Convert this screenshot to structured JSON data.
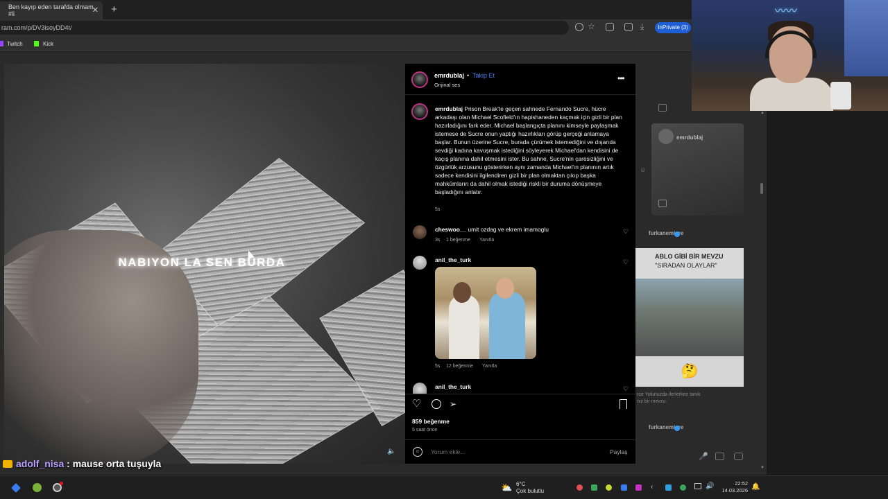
{
  "browser": {
    "tab_title": "Ben kayıp eden tarafda olmam. #li",
    "tab_close": "✕",
    "new_tab": "+",
    "url": "ram.com/p/DV3isoyDD4t/",
    "inprivate_label": "InPrivate (3)",
    "bookmarks": [
      {
        "label": "Twitch",
        "color": "#9146ff"
      },
      {
        "label": "Kick",
        "color": "#53fc18"
      }
    ]
  },
  "video": {
    "overlay_text": "NABIYON LA SEN BURDA",
    "mute_icon": "🔈"
  },
  "post": {
    "username": "emrdublaj",
    "dot": "•",
    "follow_label": "Takip Et",
    "audio_label": "Orijinal ses",
    "more_label": "•••",
    "caption_user": "emrdublaj",
    "caption_text": "Prison Break'te geçen sahnede Fernando Sucre, hücre arkadaşı olan Michael Scofield'ın hapishaneden kaçmak için gizli bir plan hazırladığını fark eder. Michael başlangıçta planını kimseyle paylaşmak istemese de Sucre onun yaptığı hazırlıkları görüp gerçeği anlamaya başlar. Bunun üzerine Sucre, burada çürümek istemediğini ve dışarıda sevdiği kadına kavuşmak istediğini söyleyerek Michael'dan kendisini de kaçış planına dahil etmesini ister. Bu sahne, Sucre'nin çaresizliğini ve özgürlük arzusunu gösterirken aynı zamanda Michael'ın planının artık sadece kendisini ilgilendiren gizli bir plan olmaktan çıkıp başka mahkûmların da dahil olmak istediği riskli bir duruma dönüşmeye başladığını anlatır.",
    "caption_time": "5s",
    "comments": [
      {
        "user": "cheswoo__",
        "text": "umit ozdag ve ekrem imamoglu",
        "time": "3s",
        "likes": "1 beğenme",
        "reply": "Yanıtla"
      },
      {
        "user": "anil_the_turk",
        "text": "",
        "time": "5s",
        "likes": "12 beğenme",
        "reply": "Yanıtla"
      },
      {
        "user": "anil_the_turk",
        "text": "",
        "time": "",
        "likes": "",
        "reply": ""
      }
    ],
    "like_count": "859 beğenme",
    "posted_ago": "5 saat önce",
    "comment_placeholder": "Yorum ekle...",
    "share_label": "Paylaş",
    "emoji_icon": "☺"
  },
  "feed": {
    "card1_user": "emrdublaj",
    "user": "furkanemirce",
    "card2_title": "ABLO GİBİ BİR MEVZU",
    "card2_subtitle": "\"SIRADAN OLAYLAR\"",
    "card3_emoji": "🤔",
    "desc": "rce Yolunuzda ilerlerken tanık\nniz bir mevzu."
  },
  "chat": {
    "username": "adolf_nisa",
    "message": " : mause orta tuşuyla"
  },
  "taskbar": {
    "weather_temp": "6°C",
    "weather_desc": "Çok bulutlu",
    "time": "22:52",
    "date": "14.03.2026"
  }
}
